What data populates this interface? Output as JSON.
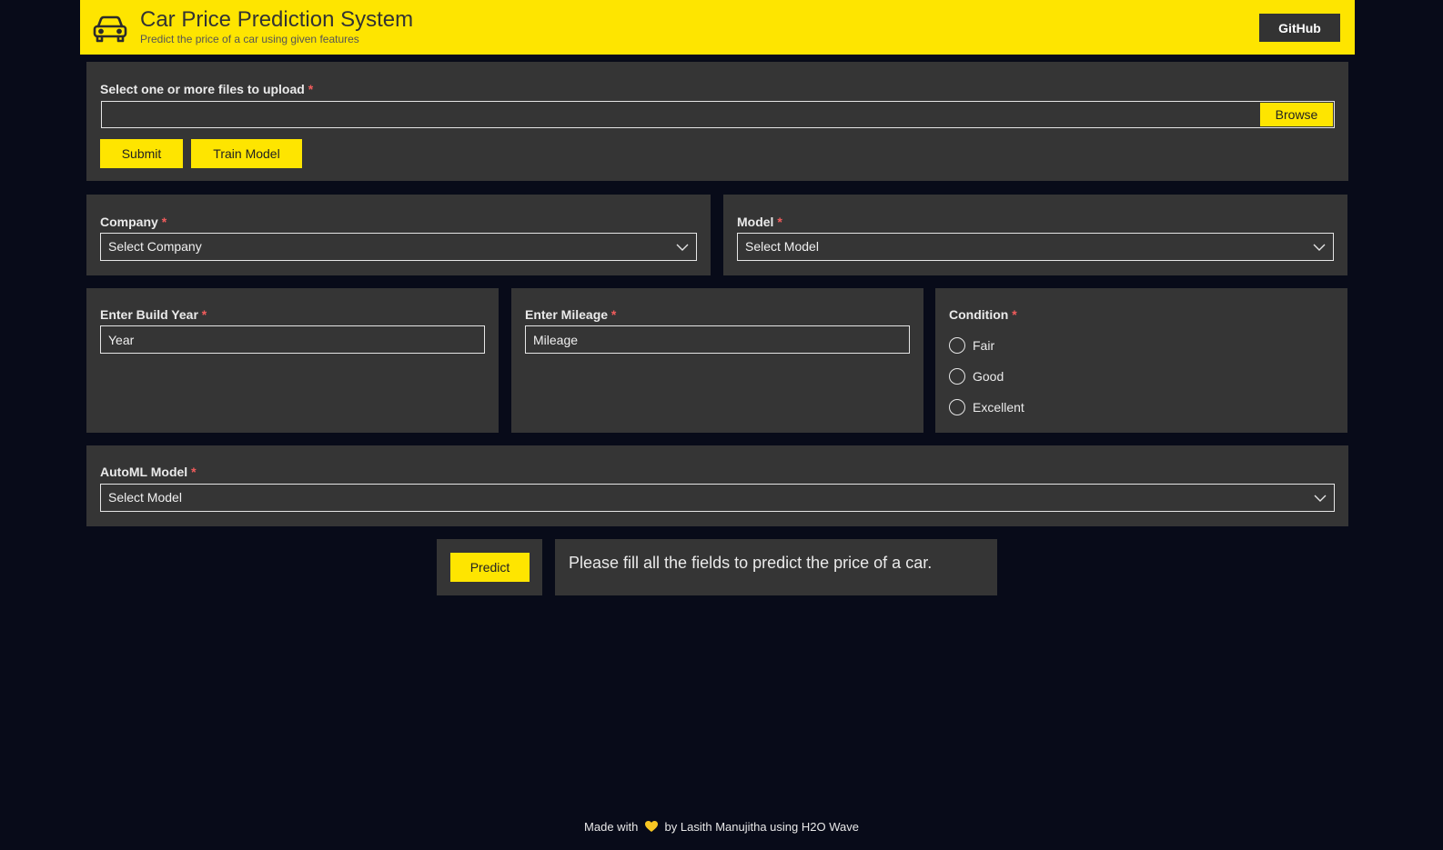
{
  "header": {
    "title": "Car Price Prediction System",
    "subtitle": "Predict the price of a car using given features",
    "github_label": "GitHub",
    "icon": "car-icon"
  },
  "upload": {
    "label": "Select one or more files to upload",
    "required_mark": "*",
    "browse_label": "Browse",
    "submit_label": "Submit",
    "train_label": "Train Model"
  },
  "company": {
    "label": "Company",
    "required_mark": "*",
    "value": "Select Company"
  },
  "model": {
    "label": "Model",
    "required_mark": "*",
    "value": "Select Model"
  },
  "build_year": {
    "label": "Enter Build Year",
    "required_mark": "*",
    "placeholder": "Year"
  },
  "mileage": {
    "label": "Enter Mileage",
    "required_mark": "*",
    "placeholder": "Mileage"
  },
  "condition": {
    "label": "Condition",
    "required_mark": "*",
    "options": [
      "Fair",
      "Good",
      "Excellent"
    ]
  },
  "automl": {
    "label": "AutoML Model",
    "required_mark": "*",
    "value": "Select Model"
  },
  "predict": {
    "button_label": "Predict",
    "message": "Please fill all the fields to predict the price of a car."
  },
  "footer": {
    "prefix": "Made with",
    "suffix": "by Lasith Manujitha using H2O Wave"
  },
  "colors": {
    "accent": "#fee500",
    "background": "#080b19",
    "card": "#353535",
    "required": "#f25c5c"
  }
}
